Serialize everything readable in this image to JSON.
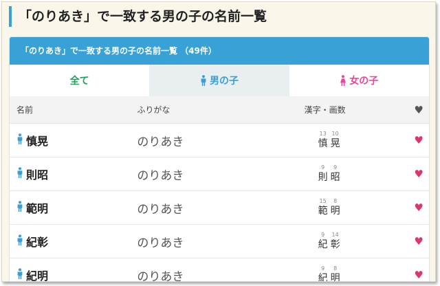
{
  "page": {
    "heading": "「のりあき」で一致する男の子の名前一覧"
  },
  "panel": {
    "title": "「のりあき」で一致する男の子の名前一覧 （49件）"
  },
  "tabs": [
    {
      "label": "全て",
      "icon": ""
    },
    {
      "label": "男の子",
      "icon": "boy-icon"
    },
    {
      "label": "女の子",
      "icon": "girl-icon"
    }
  ],
  "table": {
    "headers": {
      "name": "名前",
      "kana": "ふりがな",
      "kanji": "漢字・画数",
      "fav": "heart-icon"
    },
    "rows": [
      {
        "name": "慎晃",
        "kana": "のりあき",
        "kanji": [
          {
            "char": "慎",
            "strokes": "13"
          },
          {
            "char": "晃",
            "strokes": "10"
          }
        ]
      },
      {
        "name": "則昭",
        "kana": "のりあき",
        "kanji": [
          {
            "char": "則",
            "strokes": "9"
          },
          {
            "char": "昭",
            "strokes": "9"
          }
        ]
      },
      {
        "name": "範明",
        "kana": "のりあき",
        "kanji": [
          {
            "char": "範",
            "strokes": "15"
          },
          {
            "char": "明",
            "strokes": "8"
          }
        ]
      },
      {
        "name": "紀彰",
        "kana": "のりあき",
        "kanji": [
          {
            "char": "紀",
            "strokes": "9"
          },
          {
            "char": "彰",
            "strokes": "14"
          }
        ]
      },
      {
        "name": "紀明",
        "kana": "のりあき",
        "kanji": [
          {
            "char": "紀",
            "strokes": "9"
          },
          {
            "char": "明",
            "strokes": "8"
          }
        ]
      }
    ]
  },
  "colors": {
    "accent_blue": "#38a2d6",
    "all_green": "#22a05a",
    "girl_pink": "#e8489a",
    "heart_red": "#d9376e"
  }
}
